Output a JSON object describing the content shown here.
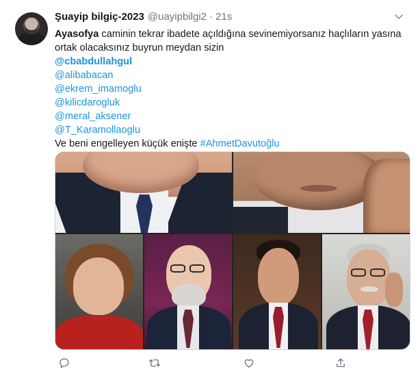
{
  "tweet": {
    "display_name": "Şuayip bilgiç-2023",
    "handle": "@uayipbilgi2",
    "separator": "·",
    "time": "21s",
    "lines": {
      "l1_bold": "Ayasofya",
      "l1_rest": " caminin tekrar ibadete açıldığına sevinemiyorsanız haçlıların yasına",
      "l2": "ortak olacaksınız buyrun meydan sizin",
      "m1": "@cbabdullahgul",
      "m2": "@alibabacan",
      "m3": "@ekrem_imamoglu",
      "m4": "@kilicdarogluk",
      "m5": "@meral_aksener",
      "m6": "@T_Karamollaoglu",
      "last_text": "Ve beni engelleyen küçük enişte ",
      "hashtag": "#AhmetDavutoğlu"
    }
  },
  "icons": {
    "caret": "chevron-down-icon",
    "reply": "reply-icon",
    "retweet": "retweet-icon",
    "like": "heart-icon",
    "share": "share-icon"
  },
  "colors": {
    "link": "#1b95e0",
    "text": "#14171a",
    "muted": "#657786",
    "border": "#ccd6dd"
  }
}
